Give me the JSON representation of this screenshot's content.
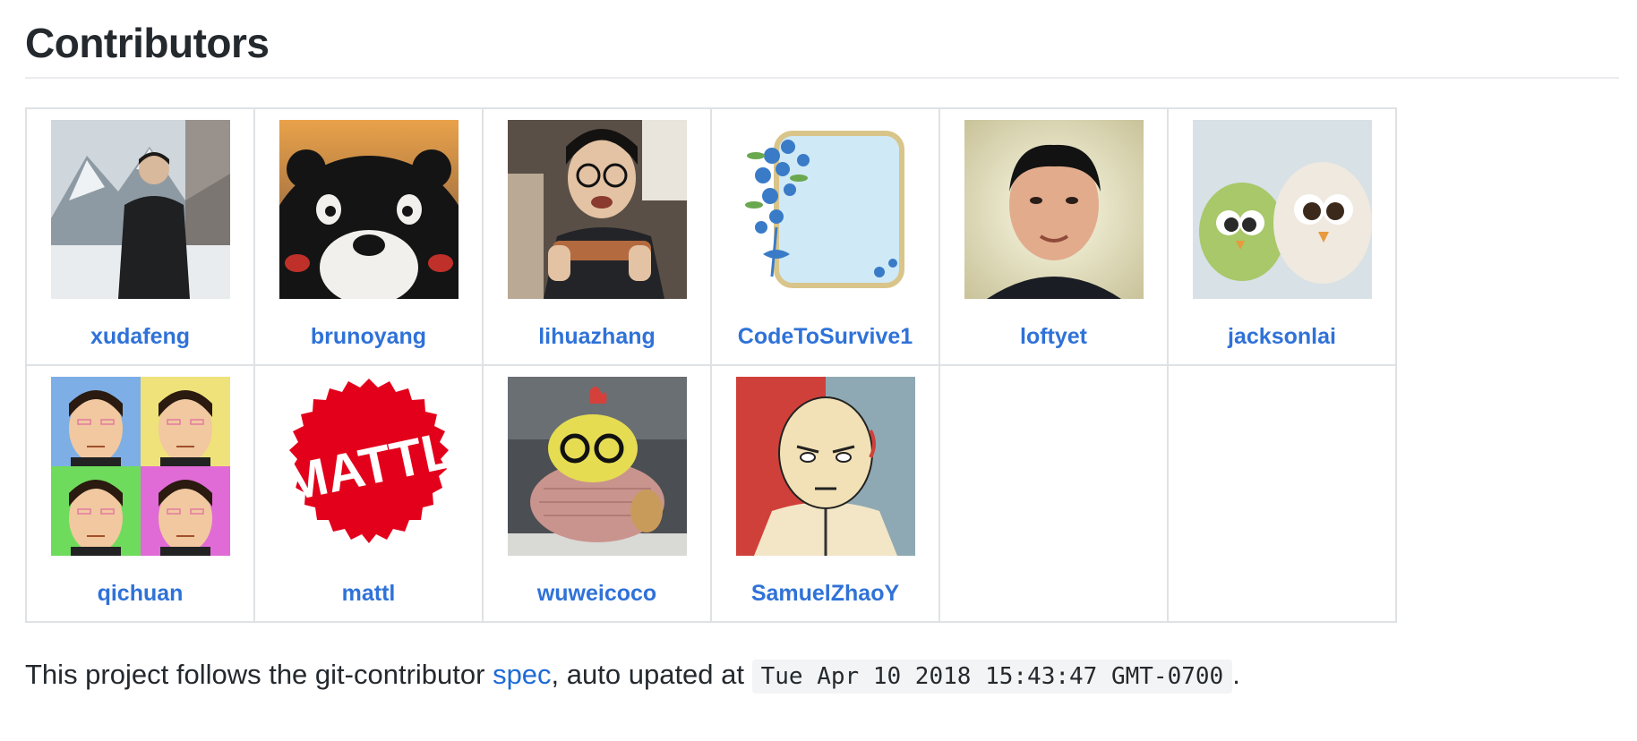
{
  "heading": "Contributors",
  "contributors": [
    {
      "name": "xudafeng"
    },
    {
      "name": "brunoyang"
    },
    {
      "name": "lihuazhang"
    },
    {
      "name": "CodeToSurvive1"
    },
    {
      "name": "loftyet"
    },
    {
      "name": "jacksonlai"
    },
    {
      "name": "qichuan"
    },
    {
      "name": "mattl",
      "logo_text": "MATTL"
    },
    {
      "name": "wuweicoco"
    },
    {
      "name": "SamuelZhaoY"
    }
  ],
  "footer": {
    "prefix": "This project follows the git-contributor ",
    "link": "spec",
    "middle": ", auto upated at ",
    "timestamp": "Tue Apr 10 2018 15:43:47 GMT-0700",
    "suffix": "."
  },
  "colors": {
    "link": "#2f72d8",
    "border": "#dfe2e5",
    "mattl_red": "#e3001b"
  }
}
